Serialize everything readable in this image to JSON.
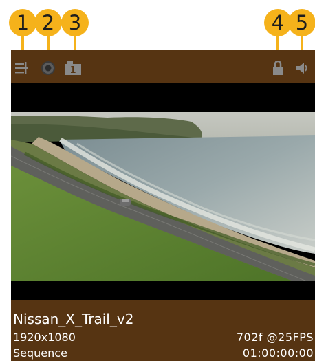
{
  "callouts": [
    "1",
    "2",
    "3",
    "4",
    "5"
  ],
  "colors": {
    "callout": "#f5b21b",
    "panel_bg": "#563412",
    "icon": "#8a8a8a",
    "text": "#ffffff"
  },
  "toolbar": {
    "icons": [
      {
        "name": "list-settings-icon"
      },
      {
        "name": "record-disc-icon"
      },
      {
        "name": "layer-count-icon",
        "badge": "1"
      },
      {
        "name": "lock-icon"
      },
      {
        "name": "speaker-icon"
      }
    ]
  },
  "clip": {
    "name": "Nissan_X_Trail_v2",
    "resolution": "1920x1080",
    "frames_fps": "702f @25FPS",
    "type": "Sequence",
    "timecode": "01:00:00:00"
  }
}
